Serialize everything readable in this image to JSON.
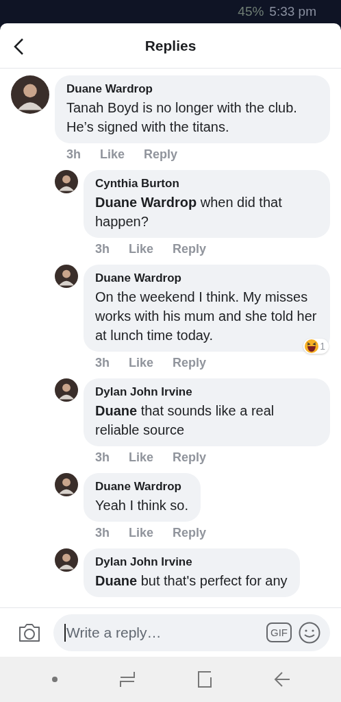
{
  "status_bar": {
    "battery": "45%",
    "time": "5:33 pm"
  },
  "header": {
    "title": "Replies"
  },
  "comments": [
    {
      "kind": "main",
      "author": "Duane Wardrop",
      "text": "Tanah Boyd is no longer with the club. He’s signed with the titans.",
      "time": "3h",
      "like": "Like",
      "reply": "Reply"
    },
    {
      "kind": "reply",
      "author": "Cynthia Burton",
      "text": "**Duane Wardrop** when did that happen?",
      "time": "3h",
      "like": "Like",
      "reply": "Reply"
    },
    {
      "kind": "reply",
      "author": "Duane Wardrop",
      "text": "On the weekend I think. My misses works with his mum and she told her at lunch time today.",
      "time": "3h",
      "like": "Like",
      "reply": "Reply",
      "reaction_count": "1"
    },
    {
      "kind": "reply",
      "author": "Dylan John Irvine",
      "text": "**Duane** that sounds like a real reliable source",
      "time": "3h",
      "like": "Like",
      "reply": "Reply"
    },
    {
      "kind": "reply",
      "author": "Duane Wardrop",
      "text": "Yeah I think so.",
      "time": "3h",
      "like": "Like",
      "reply": "Reply"
    },
    {
      "kind": "reply",
      "author": "Dylan John Irvine",
      "text": "**Duane** but that's perfect for any"
    }
  ],
  "composer": {
    "placeholder": "Write a reply…",
    "gif": "GIF"
  }
}
